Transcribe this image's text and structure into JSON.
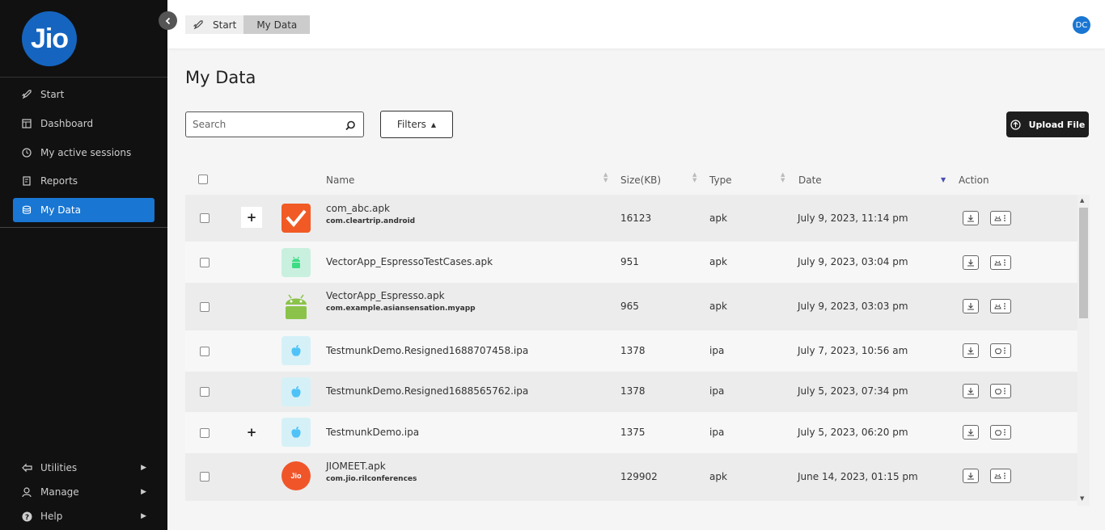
{
  "brand": {
    "logo_text": "Jio",
    "color": "#1565c0"
  },
  "sidebar": {
    "items": [
      {
        "label": "Start",
        "icon": "rocket-icon"
      },
      {
        "label": "Dashboard",
        "icon": "dashboard-icon"
      },
      {
        "label": "My active sessions",
        "icon": "clock-icon"
      },
      {
        "label": "Reports",
        "icon": "report-icon"
      },
      {
        "label": "My Data",
        "icon": "database-icon",
        "active": true
      }
    ],
    "bottom": [
      {
        "label": "Utilities",
        "icon": "tools-icon"
      },
      {
        "label": "Manage",
        "icon": "person-icon"
      },
      {
        "label": "Help",
        "icon": "help-icon"
      }
    ]
  },
  "breadcrumb": {
    "start": "Start",
    "current": "My Data"
  },
  "user": {
    "initials": "DC"
  },
  "page": {
    "title": "My Data"
  },
  "toolbar": {
    "search_placeholder": "Search",
    "filters_label": "Filters",
    "upload_label": "Upload File"
  },
  "table": {
    "columns": {
      "name": "Name",
      "size": "Size(KB)",
      "type": "Type",
      "date": "Date",
      "action": "Action"
    },
    "rows": [
      {
        "name": "com_abc.apk",
        "package": "com.cleartrip.android",
        "size": "16123",
        "type": "apk",
        "date": "July 9, 2023, 11:14 pm",
        "expand": true,
        "icon": "cleartrip-icon"
      },
      {
        "name": "VectorApp_EspressoTestCases.apk",
        "package": "",
        "size": "951",
        "type": "apk",
        "date": "July 9, 2023, 03:04 pm",
        "expand": false,
        "icon": "android-icon"
      },
      {
        "name": "VectorApp_Espresso.apk",
        "package": "com.example.asiansensation.myapp",
        "size": "965",
        "type": "apk",
        "date": "July 9, 2023, 03:03 pm",
        "expand": false,
        "icon": "android-icon"
      },
      {
        "name": "TestmunkDemo.Resigned1688707458.ipa",
        "package": "",
        "size": "1378",
        "type": "ipa",
        "date": "July 7, 2023, 10:56 am",
        "expand": false,
        "icon": "apple-icon"
      },
      {
        "name": "TestmunkDemo.Resigned1688565762.ipa",
        "package": "",
        "size": "1378",
        "type": "ipa",
        "date": "July 5, 2023, 07:34 pm",
        "expand": false,
        "icon": "apple-icon"
      },
      {
        "name": "TestmunkDemo.ipa",
        "package": "",
        "size": "1375",
        "type": "ipa",
        "date": "July 5, 2023, 06:20 pm",
        "expand": true,
        "icon": "apple-icon"
      },
      {
        "name": "JIOMEET.apk",
        "package": "com.jio.rilconferences",
        "size": "129902",
        "type": "apk",
        "date": "June 14, 2023, 01:15 pm",
        "expand": false,
        "icon": "jiomeet-icon",
        "icon_text": "Jio"
      }
    ]
  },
  "colors": {
    "accent": "#1976d2",
    "sidebar_bg": "#111111",
    "upload_bg": "#1e1e1e"
  }
}
